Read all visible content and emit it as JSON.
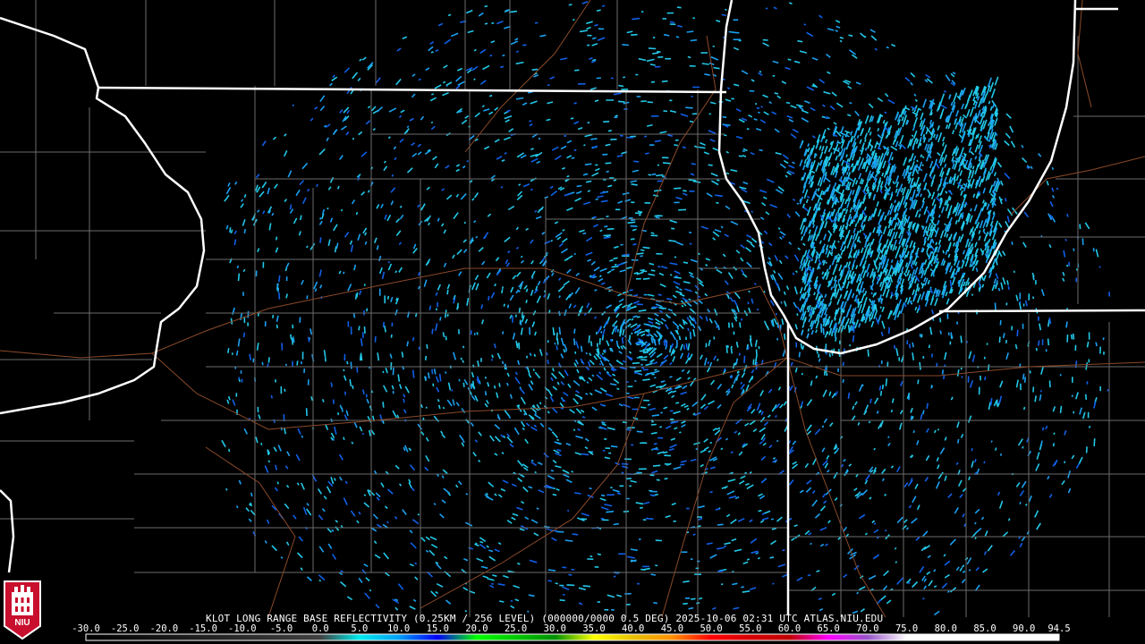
{
  "header": {
    "caption": "KLOT LONG RANGE BASE REFLECTIVITY (0.25KM / 256 LEVEL) (000000/0000 0.5 DEG) 2025-10-06 02:31 UTC  ATLAS.NIU.EDU"
  },
  "logo": {
    "text": "NIU"
  },
  "colorscale": {
    "labels": [
      "-30.0",
      "-25.0",
      "-20.0",
      "-15.0",
      "-10.0",
      "-5.0",
      "0.0",
      "5.0",
      "10.0",
      "15.0",
      "20.0",
      "25.0",
      "30.0",
      "35.0",
      "40.0",
      "45.0",
      "50.0",
      "55.0",
      "60.0",
      "65.0",
      "70.0",
      "75.0",
      "80.0",
      "85.0",
      "90.0",
      "94.5"
    ],
    "min": -30.0,
    "max": 94.5,
    "stops": [
      {
        "v": -30,
        "c": "#000000"
      },
      {
        "v": 0,
        "c": "#404040"
      },
      {
        "v": 5,
        "c": "#00ecec"
      },
      {
        "v": 10,
        "c": "#01a0f6"
      },
      {
        "v": 15,
        "c": "#0000f6"
      },
      {
        "v": 20,
        "c": "#00ff00"
      },
      {
        "v": 25,
        "c": "#00c800"
      },
      {
        "v": 30,
        "c": "#009000"
      },
      {
        "v": 35,
        "c": "#ffff00"
      },
      {
        "v": 40,
        "c": "#e7c000"
      },
      {
        "v": 45,
        "c": "#ff9000"
      },
      {
        "v": 50,
        "c": "#ff0000"
      },
      {
        "v": 55,
        "c": "#d60000"
      },
      {
        "v": 60,
        "c": "#c00000"
      },
      {
        "v": 65,
        "c": "#ff00ff"
      },
      {
        "v": 70,
        "c": "#9955c9"
      },
      {
        "v": 75,
        "c": "#ffffff"
      },
      {
        "v": 94.5,
        "c": "#ffffff"
      }
    ]
  },
  "colors": {
    "background": "#000000",
    "state_border": "#ffffff",
    "county_border": "#6b6b6b",
    "highway": "#8a4a2a",
    "echo_light": "#22c8e8",
    "echo_mid": "#1aa0f0",
    "echo_dark": "#1060e8"
  }
}
